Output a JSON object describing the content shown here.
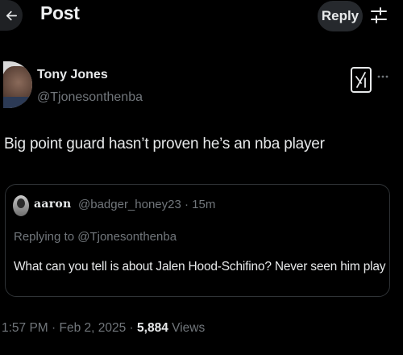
{
  "header": {
    "title": "Post",
    "reply_label": "Reply",
    "back_icon": "arrow-left-icon",
    "settings_icon": "sliders-icon"
  },
  "author": {
    "name": "Tony Jones",
    "handle": "@Tjonesonthenba",
    "grok_icon": "grok-icon",
    "more_icon": "more-horizontal-icon"
  },
  "post": {
    "text": "Big point guard hasn’t proven he’s an nba player",
    "timestamp": "1:57 PM · Feb 2, 2025",
    "separator": "·",
    "views_count": "5,884",
    "views_label": "Views"
  },
  "quoted": {
    "name": "aaron",
    "handle": "@badger_honey23 · 15m",
    "replying_label": "Replying to",
    "replying_to": "@Tjonesonthenba",
    "text": "What can you tell is about Jalen Hood-Schifino? Never seen him play"
  },
  "colors": {
    "background": "#000000",
    "text": "#e7e9ea",
    "muted": "#71767b",
    "border": "#2f3336"
  }
}
